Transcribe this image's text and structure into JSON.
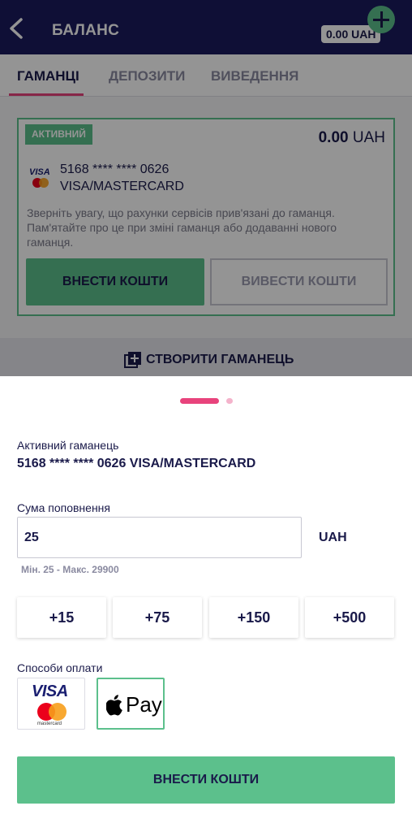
{
  "header": {
    "title": "БАЛАНС",
    "balance": "0.00 UAH"
  },
  "tabs": [
    {
      "label": "ГАМАНЦІ",
      "active": true
    },
    {
      "label": "ДЕПОЗИТИ",
      "active": false
    },
    {
      "label": "ВИВЕДЕННЯ",
      "active": false
    }
  ],
  "wallet_card": {
    "badge": "АКТИВНИЙ",
    "amount": "0.00",
    "currency": "UAH",
    "card_number": "5168 **** **** 0626",
    "card_type": "VISA/MASTERCARD",
    "notice": "Зверніть увагу, що рахунки сервісів прив'язані до гаманця. Пам'ятайте про це при зміні гаманця або додаванні нового гаманця.",
    "deposit_label": "ВНЕСТИ КОШТИ",
    "withdraw_label": "ВИВЕСТИ КОШТИ"
  },
  "create_wallet_label": "СТВОРИТИ ГАМАНЕЦЬ",
  "sheet": {
    "pager": {
      "pages": 2,
      "current": 1
    },
    "active_wallet_label": "Активний гаманець",
    "active_wallet_value": "5168 **** **** 0626 VISA/MASTERCARD",
    "amount_label": "Сума поповнення",
    "amount_value": "25",
    "currency": "UAH",
    "limits": "Мін. 25 - Макс. 29900",
    "quick_amounts": [
      "+15",
      "+75",
      "+150",
      "+500"
    ],
    "methods_label": "Способи оплати",
    "methods": [
      {
        "name": "visa-mastercard",
        "visa_text": "VISA",
        "mc_text": "mastercard",
        "selected": false
      },
      {
        "name": "apple-pay",
        "pay_text": "Pay",
        "selected": true
      }
    ],
    "submit_label": "ВНЕСТИ КОШТИ"
  },
  "colors": {
    "header_bg": "#1a1a5e",
    "accent_green": "#5cc08c",
    "accent_pink": "#e8437c",
    "text_dark": "#1a1a4a"
  }
}
